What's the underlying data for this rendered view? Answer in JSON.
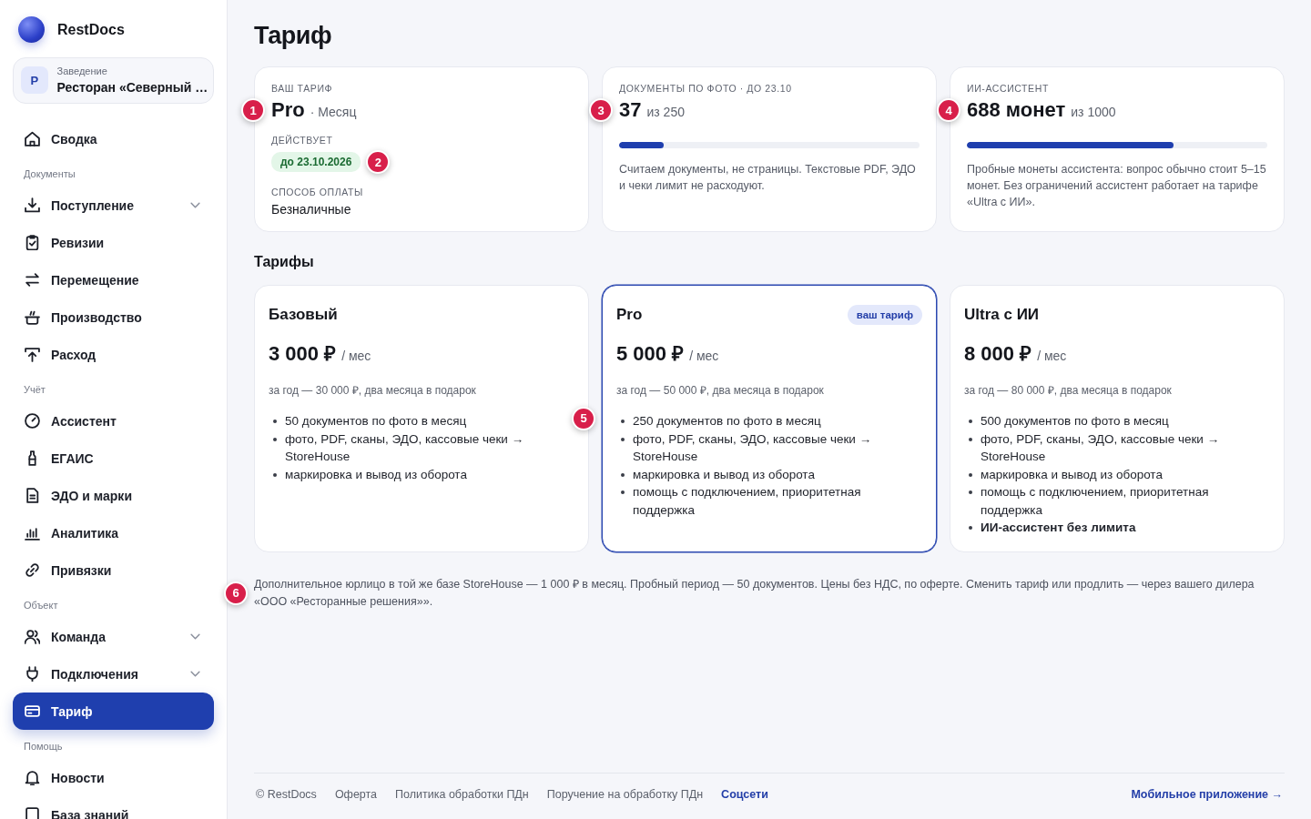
{
  "sidebar": {
    "brand": "RestDocs",
    "venue": {
      "avatar": "Р",
      "label": "Заведение",
      "name": "Ресторан «Северный …"
    },
    "sections": [
      {
        "items": [
          {
            "label": "Сводка",
            "selected": false
          }
        ]
      },
      {
        "label": "Документы",
        "items": [
          {
            "label": "Поступление",
            "selected": false,
            "expanded": false
          },
          {
            "label": "Ревизии",
            "selected": false
          },
          {
            "label": "Перемещение",
            "selected": false
          },
          {
            "label": "Производство",
            "selected": false
          },
          {
            "label": "Расход",
            "selected": false
          }
        ]
      },
      {
        "label": "Учёт",
        "items": [
          {
            "label": "Ассистент",
            "selected": false
          },
          {
            "label": "ЕГАИС",
            "selected": false
          },
          {
            "label": "ЭДО и марки",
            "selected": false
          },
          {
            "label": "Аналитика",
            "selected": false
          },
          {
            "label": "Привязки",
            "selected": false
          }
        ]
      },
      {
        "label": "Объект",
        "items": [
          {
            "label": "Команда",
            "selected": false,
            "expanded": false
          },
          {
            "label": "Подключения",
            "selected": false,
            "expanded": false
          },
          {
            "label": "Тариф",
            "selected": true
          }
        ]
      },
      {
        "label": "Помощь",
        "items": [
          {
            "label": "Новости",
            "selected": false
          },
          {
            "label": "База знаний",
            "selected": false
          }
        ]
      }
    ]
  },
  "page": {
    "title": "Тариф"
  },
  "summary_cards": [
    {
      "kind": "plan",
      "label": "ВАШ ТАРИФ",
      "value": "Pro",
      "suffix": "· Месяц",
      "marker": "1",
      "valid_label": "ДЕЙСТВУЕТ",
      "valid_badge": "до 23.10.2026",
      "badge_marker": "2",
      "payment_label": "СПОСОБ ОПЛАТЫ",
      "payment": "Безналичные"
    },
    {
      "kind": "meter",
      "label": "ДОКУМЕНТЫ ПО ФОТО · ДО 23.10",
      "value": "37",
      "suffix": "из 250",
      "marker": "3",
      "level": 0.148,
      "note": "Считаем документы, не страницы. Текстовые PDF, ЭДО и чеки лимит не расходуют."
    },
    {
      "kind": "meter",
      "label": "ИИ-АССИСТЕНТ",
      "value": "688 монет",
      "suffix": "из 1000",
      "marker": "4",
      "level": 0.688,
      "note": "Пробные монеты ассистента: вопрос обычно стоит 5–15 монет. Без ограничений ассистент работает на тарифе «Ultra с ИИ»."
    }
  ],
  "plans_heading": "Тарифы",
  "plans": [
    {
      "name": "Базовый",
      "price": "3 000 ₽",
      "period": "/ мес",
      "yearly": "за год — 30 000 ₽, два месяца в подарок",
      "selected": false,
      "features": [
        {
          "text": "50 документов по фото в месяц",
          "bold": false
        },
        {
          "text": "фото, PDF, сканы, ЭДО, кассовые чеки → StoreHouse",
          "bold": false
        },
        {
          "text": "маркировка и вывод из оборота",
          "bold": false
        }
      ]
    },
    {
      "name": "Pro",
      "price": "5 000 ₽",
      "period": "/ мес",
      "yearly": "за год — 50 000 ₽, два месяца в подарок",
      "selected": true,
      "badge": "ваш тариф",
      "marker": "5",
      "features": [
        {
          "text": "250 документов по фото в месяц",
          "bold": false
        },
        {
          "text": "фото, PDF, сканы, ЭДО, кассовые чеки → StoreHouse",
          "bold": false
        },
        {
          "text": "маркировка и вывод из оборота",
          "bold": false
        },
        {
          "text": "помощь с подключением, приоритетная поддержка",
          "bold": false
        }
      ]
    },
    {
      "name": "Ultra с ИИ",
      "price": "8 000 ₽",
      "period": "/ мес",
      "yearly": "за год — 80 000 ₽, два месяца в подарок",
      "selected": false,
      "features": [
        {
          "text": "500 документов по фото в месяц",
          "bold": false
        },
        {
          "text": "фото, PDF, сканы, ЭДО, кассовые чеки → StoreHouse",
          "bold": false
        },
        {
          "text": "маркировка и вывод из оборота",
          "bold": false
        },
        {
          "text": "помощь с подключением, приоритетная поддержка",
          "bold": false
        },
        {
          "text": "ИИ-ассистент без лимита",
          "bold": true
        }
      ]
    }
  ],
  "footnote": {
    "text": "Дополнительное юрлицо в той же базе StoreHouse — 1 000 ₽ в месяц. Пробный период — 50 документов. Цены без НДС, по оферте. Сменить тариф или продлить — через вашего дилера «ООО «Ресторанные решения»».",
    "marker": "6"
  },
  "footer": {
    "copyright": "© RestDocs",
    "links": [
      {
        "label": "Оферта",
        "highlighted": false
      },
      {
        "label": "Политика обработки ПДн",
        "highlighted": false
      },
      {
        "label": "Поручение на обработку ПДн",
        "highlighted": false
      },
      {
        "label": "Соцсети",
        "highlighted": true
      }
    ],
    "app_link": "Мобильное приложение →"
  }
}
